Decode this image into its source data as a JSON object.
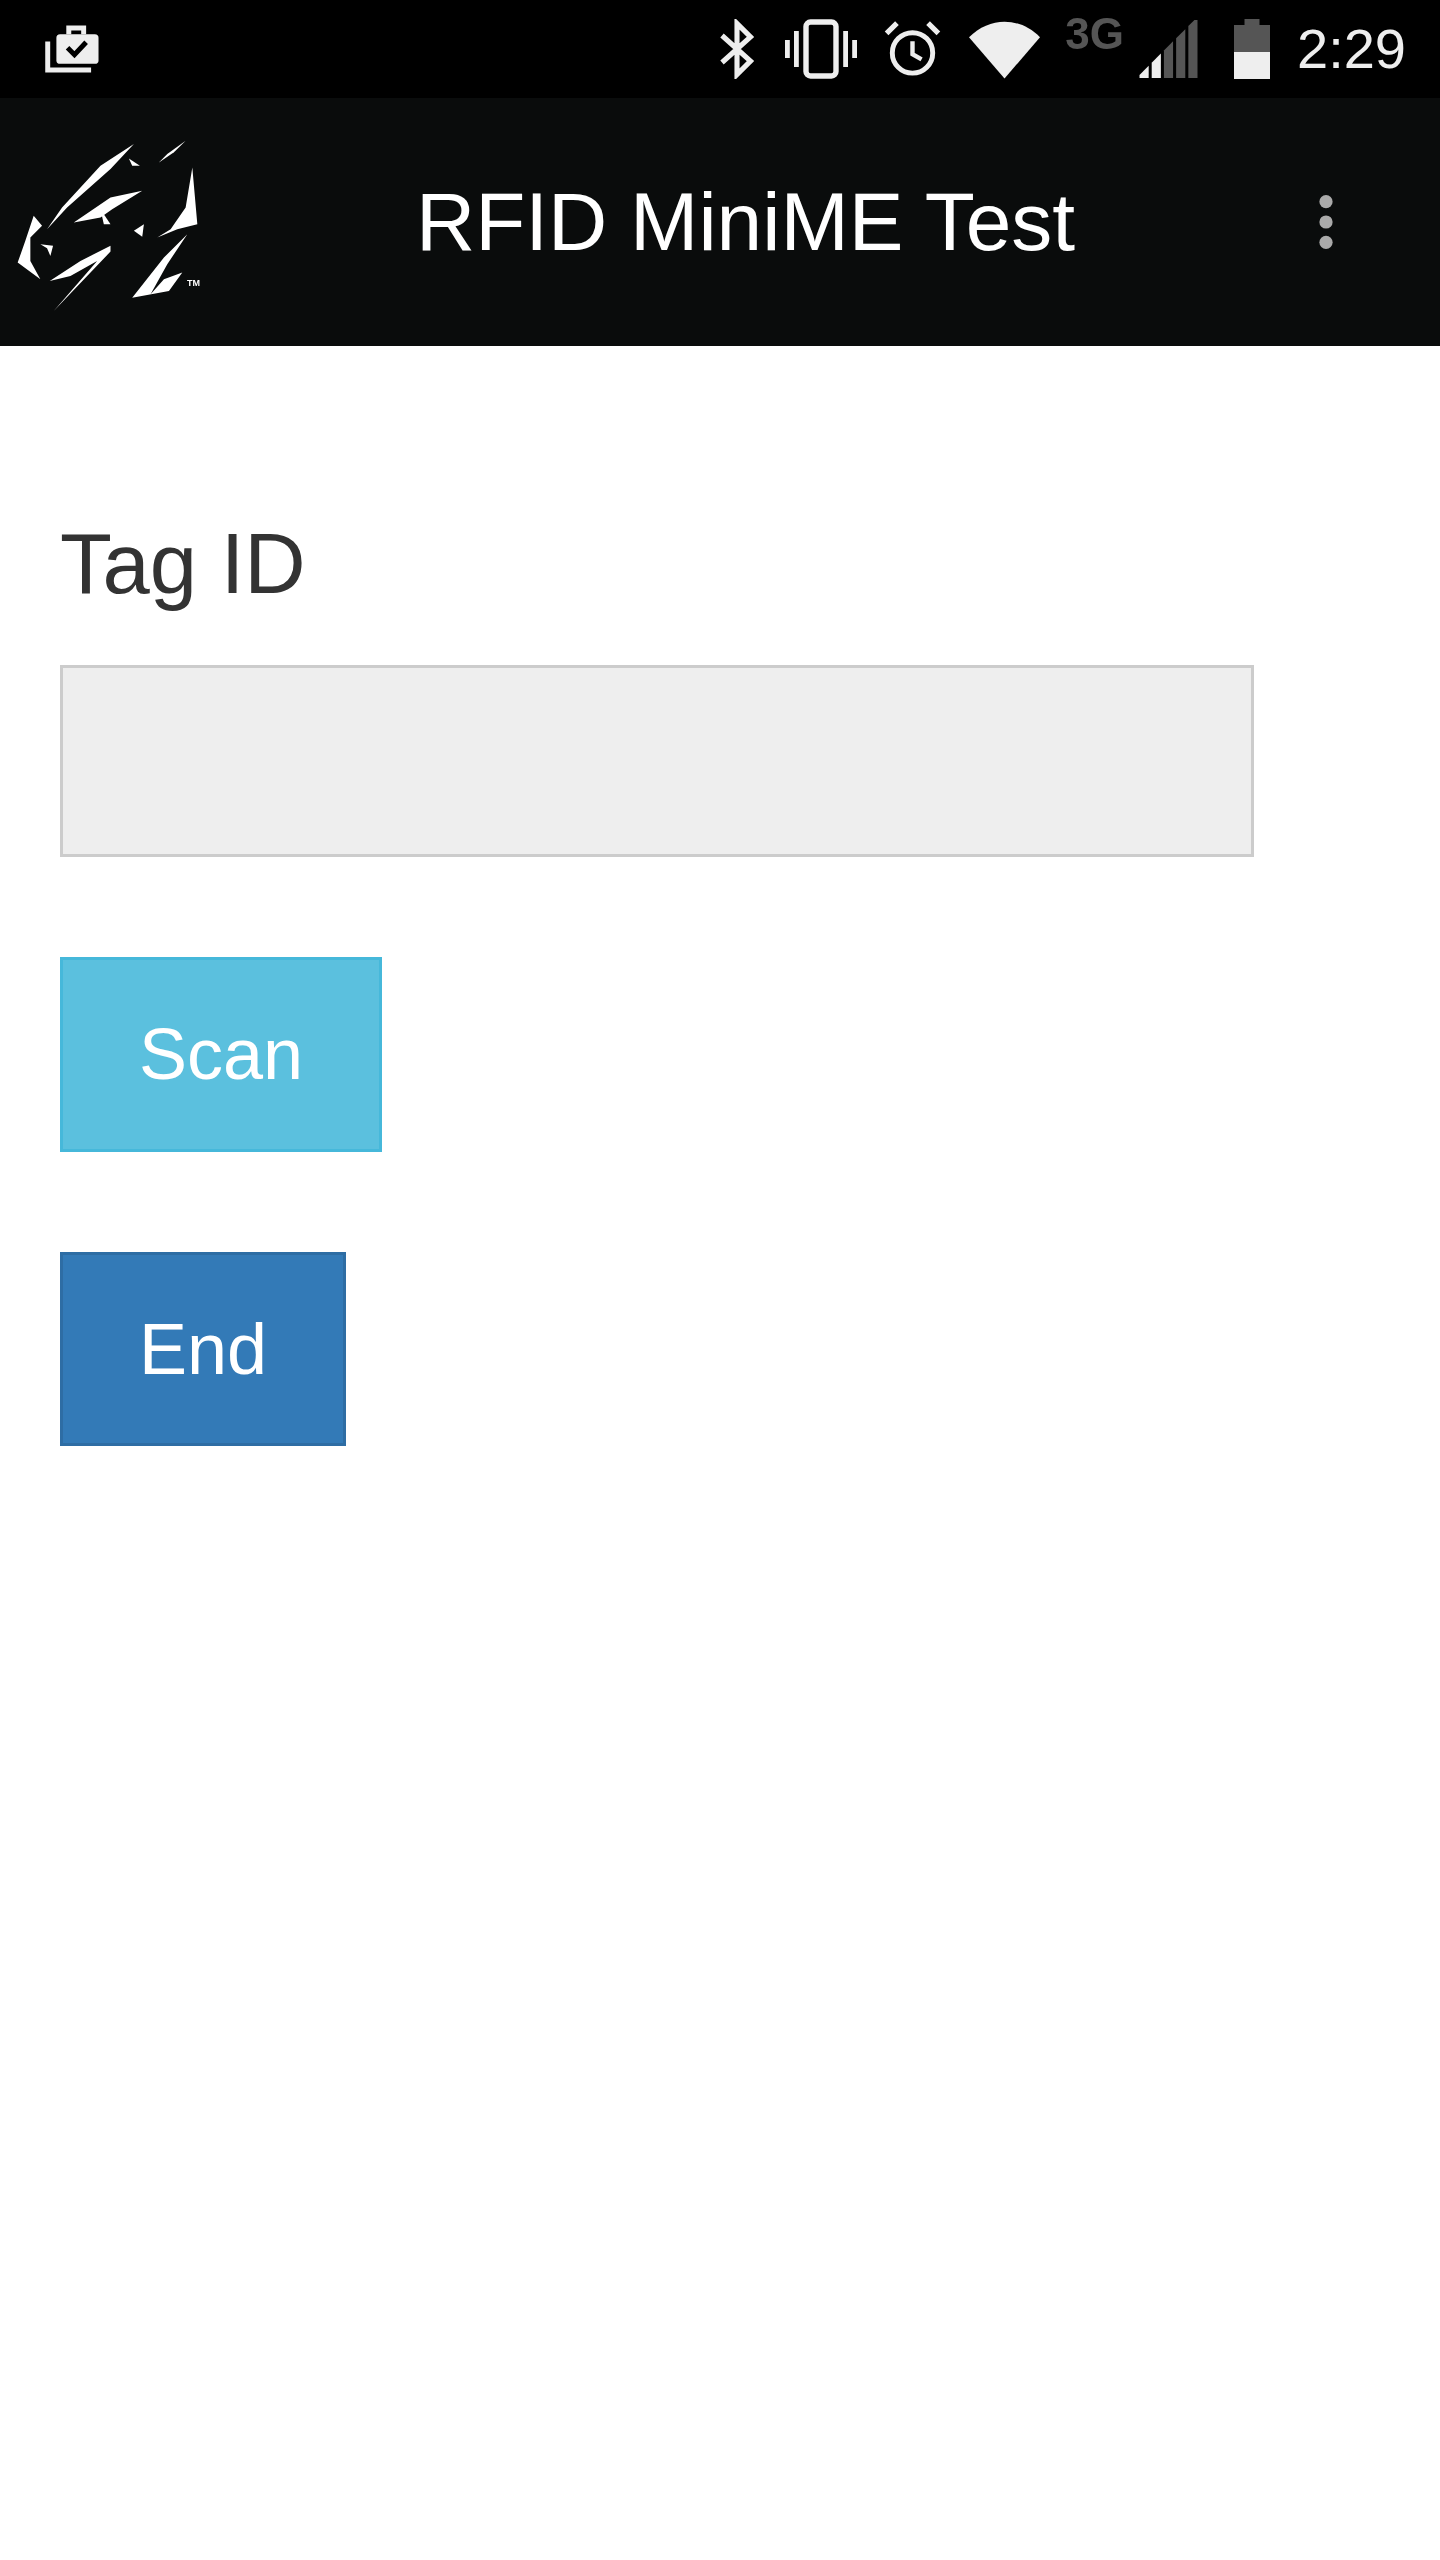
{
  "status_bar": {
    "network_type": "3G",
    "time": "2:29"
  },
  "app_bar": {
    "logo": {
      "trademark": "TM"
    },
    "title": "RFID MiniME Test"
  },
  "form": {
    "fields": [
      {
        "label": "Tag ID"
      }
    ],
    "buttons": [
      {
        "label": "Scan",
        "kind": "info"
      },
      {
        "label": "End",
        "kind": "primary"
      }
    ]
  }
}
